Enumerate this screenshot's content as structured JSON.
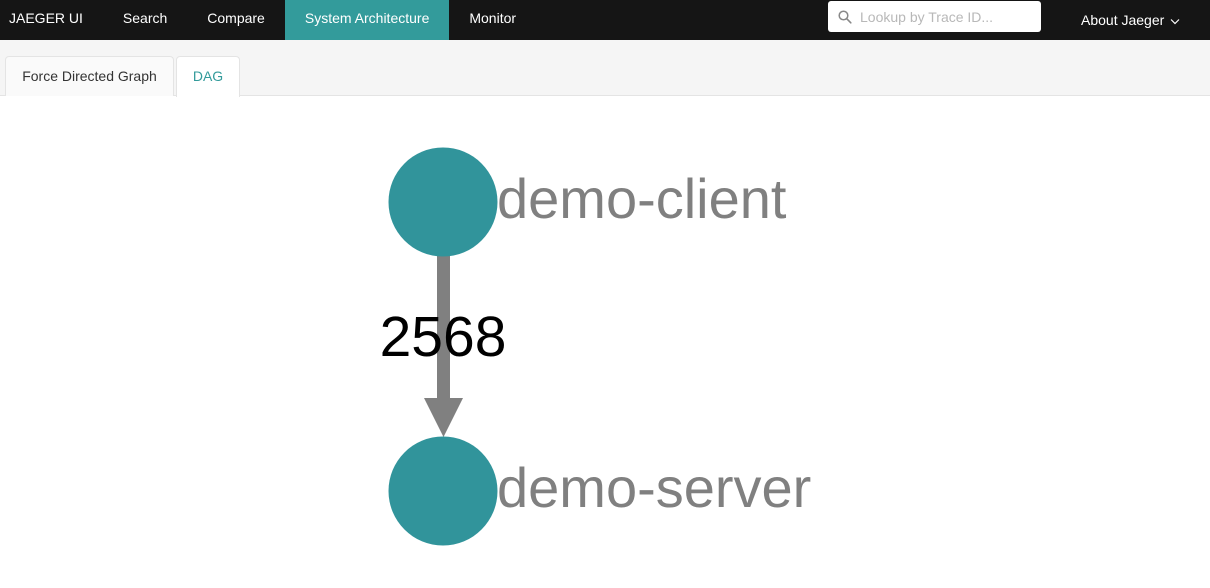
{
  "nav": {
    "brand": "JAEGER UI",
    "items": [
      {
        "label": "Search"
      },
      {
        "label": "Compare"
      },
      {
        "label": "System Architecture"
      },
      {
        "label": "Monitor"
      }
    ],
    "search_placeholder": "Lookup by Trace ID...",
    "about_label": "About Jaeger"
  },
  "tabs": [
    {
      "label": "Force Directed Graph"
    },
    {
      "label": "DAG"
    }
  ],
  "graph": {
    "nodes": [
      {
        "name": "demo-client"
      },
      {
        "name": "demo-server"
      }
    ],
    "edge": {
      "from": "demo-client",
      "to": "demo-server",
      "label": "2568"
    }
  },
  "colors": {
    "topbar": "#151515",
    "accent": "#339b9b",
    "node": "#31949b",
    "edge": "#808080",
    "node_label": "#808080"
  }
}
